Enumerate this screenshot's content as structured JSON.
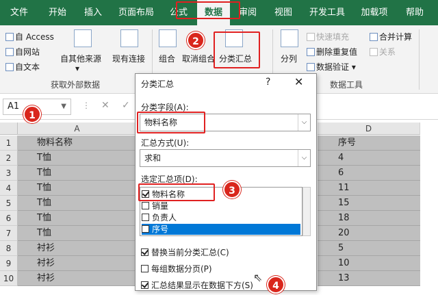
{
  "tabs": [
    "文件",
    "开始",
    "插入",
    "页面布局",
    "公式",
    "数据",
    "审阅",
    "视图",
    "开发工具",
    "加载项",
    "帮助"
  ],
  "ribbon": {
    "access": "自 Access",
    "website": "自网站",
    "text": "自文本",
    "other_sources": "自其他来源",
    "existing_connections": "现有连接",
    "group_external": "获取外部数据",
    "group_btn": "组合",
    "ungroup": "取消组合",
    "subtotal": "分类汇总",
    "text_to_columns": "分列",
    "flash_fill": "快速填充",
    "remove_duplicates": "删除重复值",
    "data_validation": "数据验证",
    "consolidate": "合并计算",
    "relationships": "关系",
    "group_tools": "数据工具"
  },
  "formula_bar": {
    "name_box": "A1",
    "cancel": "✕",
    "enter": "✓"
  },
  "columns": [
    "A",
    "D"
  ],
  "rows": [
    {
      "n": "1",
      "a": "物料名称",
      "d": "序号"
    },
    {
      "n": "2",
      "a": "T恤",
      "d": "4"
    },
    {
      "n": "3",
      "a": "T恤",
      "d": "6"
    },
    {
      "n": "4",
      "a": "T恤",
      "d": "11"
    },
    {
      "n": "5",
      "a": "T恤",
      "d": "15"
    },
    {
      "n": "6",
      "a": "T恤",
      "d": "18"
    },
    {
      "n": "7",
      "a": "T恤",
      "d": "20"
    },
    {
      "n": "8",
      "a": "衬衫",
      "d": "5"
    },
    {
      "n": "9",
      "a": "衬衫",
      "d": "10"
    },
    {
      "n": "10",
      "a": "衬衫",
      "d": "13"
    }
  ],
  "dialog": {
    "title": "分类汇总",
    "help": "?",
    "close": "✕",
    "group_by_label": "分类字段(A):",
    "group_by_value": "物料名称",
    "function_label": "汇总方式(U):",
    "function_value": "求和",
    "add_to_label": "选定汇总项(D):",
    "items": [
      {
        "label": "物料名称",
        "checked": true
      },
      {
        "label": "销量",
        "checked": false
      },
      {
        "label": "负责人",
        "checked": false
      },
      {
        "label": "序号",
        "checked": false
      }
    ],
    "replace_current": "替换当前分类汇总(C)",
    "page_break": "每组数据分页(P)",
    "summary_below": "汇总结果显示在数据下方(S)"
  },
  "badges": [
    "1",
    "2",
    "3",
    "4"
  ],
  "colors": {
    "excel_green": "#217346",
    "highlight_red": "#e02020",
    "selection_blue": "#0078d7"
  }
}
